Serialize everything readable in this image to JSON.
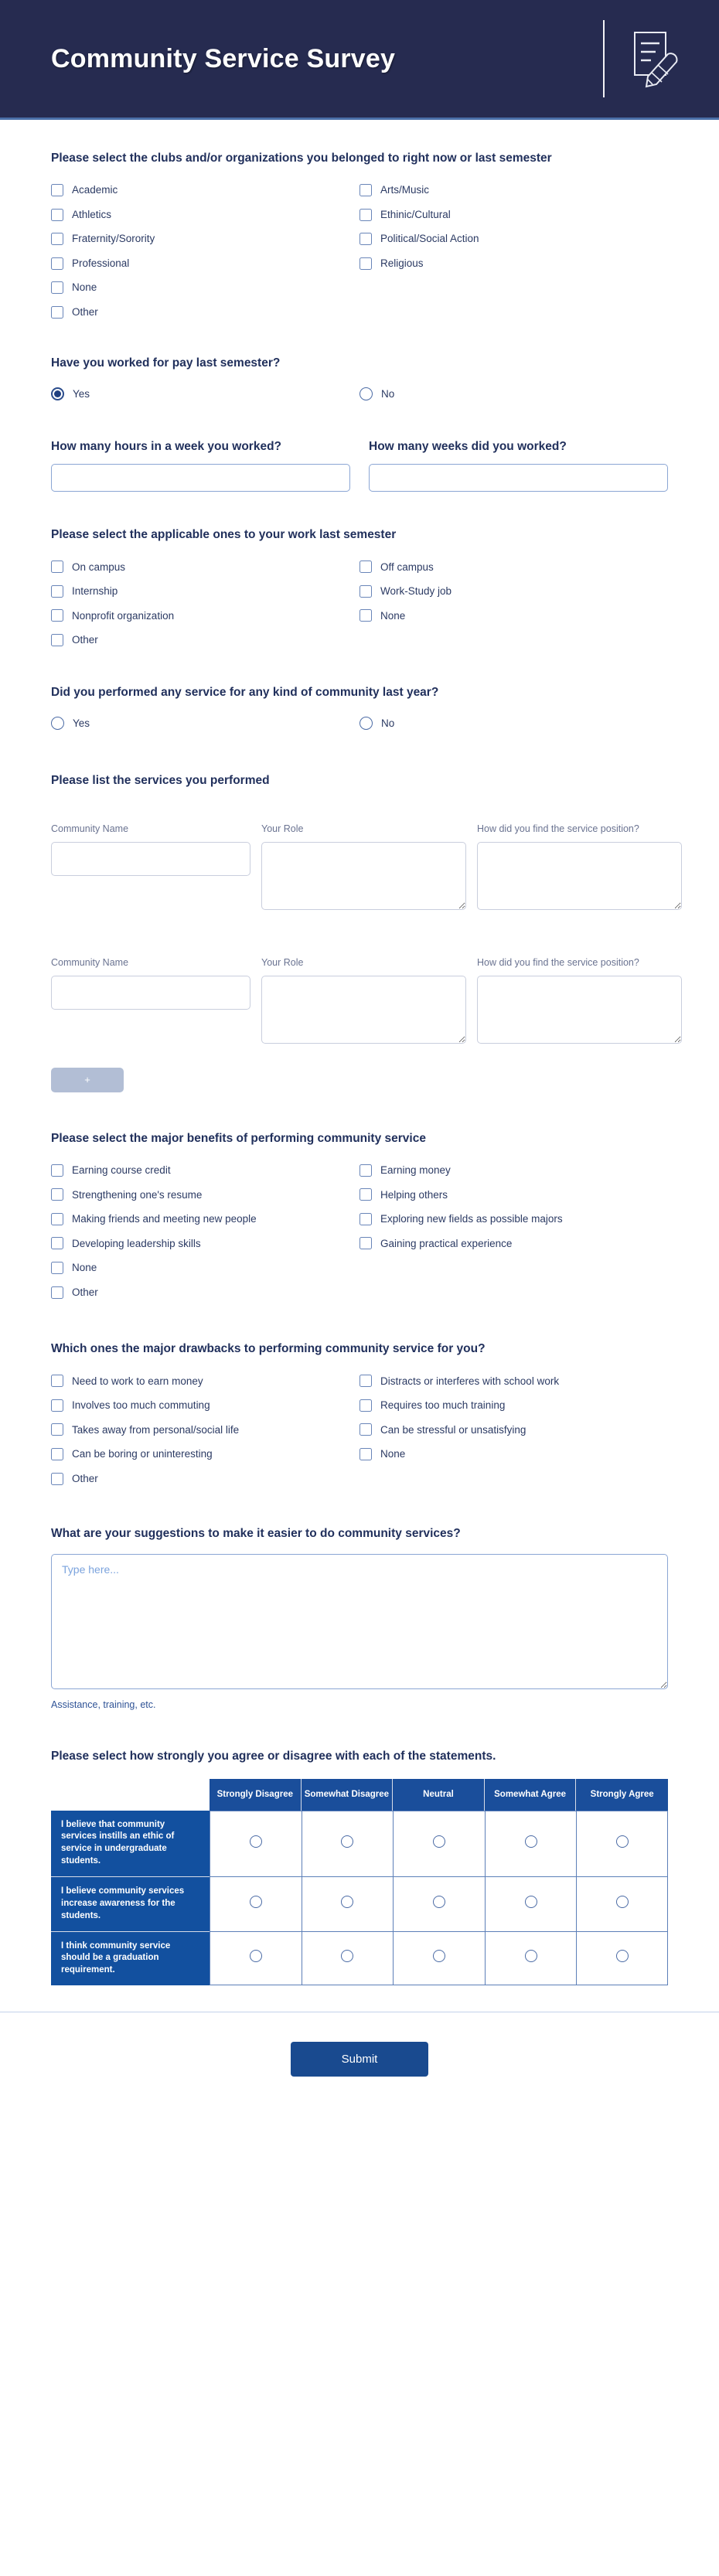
{
  "header": {
    "title": "Community Service Survey",
    "icon": "document-pencil-icon",
    "background_color": "#262b50",
    "accent_color": "#4a6fa8"
  },
  "clubs": {
    "title": "Please select the clubs and/or organizations you belonged to right now or last semester",
    "col1": [
      "Academic",
      "Athletics",
      "Fraternity/Sorority",
      "Professional"
    ],
    "col2": [
      "Arts/Music",
      "Ethinic/Cultural",
      "Political/Social Action",
      "Religious"
    ],
    "extra": [
      "None",
      "Other"
    ]
  },
  "paid_work": {
    "title": "Have you worked for pay last semester?",
    "options": [
      "Yes",
      "No"
    ],
    "selected": "Yes"
  },
  "hours": {
    "label": "How many hours in a week you worked?",
    "value": ""
  },
  "weeks": {
    "label": "How many weeks did you worked?",
    "value": ""
  },
  "work_type": {
    "title": "Please select the applicable ones to your work last semester",
    "col1": [
      "On campus",
      "Internship",
      "Nonprofit organization"
    ],
    "col2": [
      "Off campus",
      "Work-Study job",
      "None"
    ],
    "extra": [
      "Other"
    ]
  },
  "performed_service": {
    "title": "Did you performed any service for any kind of community last year?",
    "options": [
      "Yes",
      "No"
    ],
    "selected": ""
  },
  "services": {
    "title": "Please list the services you performed",
    "labels": {
      "community_name": "Community Name",
      "your_role": "Your Role",
      "how_found": "How did you find the service position?"
    },
    "rows": [
      {
        "community_name": "",
        "your_role": "",
        "how_found": ""
      },
      {
        "community_name": "",
        "your_role": "",
        "how_found": ""
      }
    ],
    "add_label": "+"
  },
  "benefits": {
    "title": "Please select the major benefits of performing community service",
    "col1": [
      "Earning course credit",
      "Strengthening one's resume",
      "Making friends and meeting new people",
      "Developing leadership skills"
    ],
    "col2": [
      "Earning money",
      "Helping others",
      "Exploring new fields as possible majors",
      "Gaining practical experience"
    ],
    "extra": [
      "None",
      "Other"
    ]
  },
  "drawbacks": {
    "title": "Which ones the major drawbacks to performing community service for you?",
    "col1": [
      "Need to work to earn money",
      "Involves too much commuting",
      "Takes away from personal/social life",
      "Can be boring or uninteresting"
    ],
    "col2": [
      "Distracts or interferes with school work",
      "Requires too much training",
      "Can be stressful or unsatisfying",
      "None"
    ],
    "extra": [
      "Other"
    ]
  },
  "suggestions": {
    "title": "What are your suggestions to make it easier to do community services?",
    "placeholder": "Type here...",
    "value": "",
    "helper": "Assistance, training, etc."
  },
  "likert": {
    "title": "Please select how strongly you agree or disagree with each of the statements.",
    "columns": [
      "Strongly Disagree",
      "Somewhat Disagree",
      "Neutral",
      "Somewhat Agree",
      "Strongly Agree"
    ],
    "rows": [
      "I believe that community services instills an ethic of service in undergraduate students.",
      "I believe community services increase awareness for the students.",
      "I think community service should be a graduation requirement."
    ],
    "header_color": "#1a4e9b",
    "row_label_color": "#12509f"
  },
  "footer": {
    "submit_label": "Submit",
    "submit_color": "#194a8f"
  }
}
